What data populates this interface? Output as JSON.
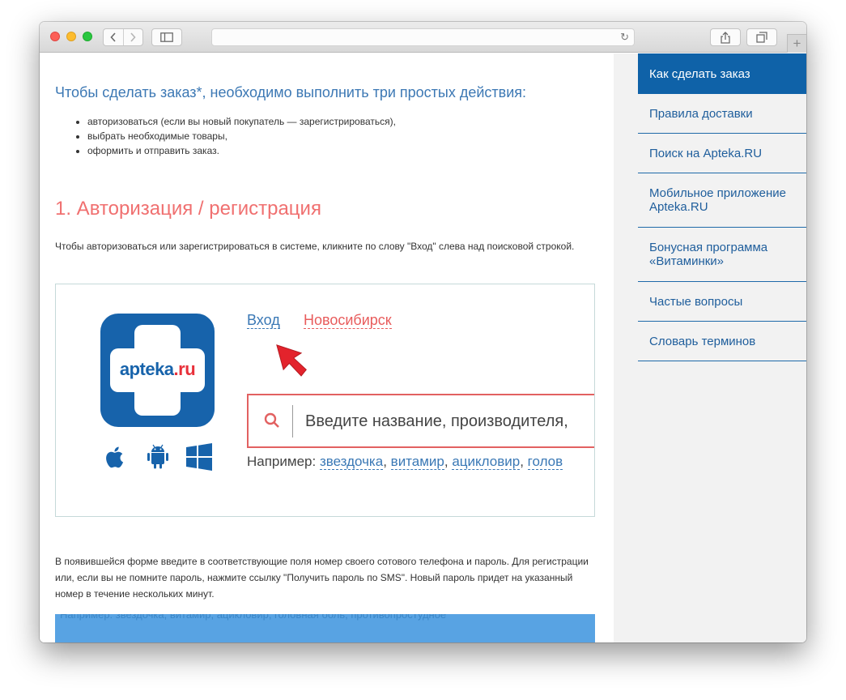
{
  "browser": {
    "reload_icon": "reload-icon",
    "back_icon": "chevron-left-icon",
    "forward_icon": "chevron-right-icon",
    "new_tab_label": "+"
  },
  "intro": {
    "heading": "Чтобы сделать заказ*, необходимо выполнить три простых действия:",
    "steps": [
      "авторизоваться (если вы новый покупатель — зарегистрироваться),",
      "выбрать необходимые товары,",
      "оформить и отправить заказ."
    ]
  },
  "section": {
    "heading": "1. Авторизация / регистрация",
    "paragraph1": "Чтобы авторизоваться или зарегистрироваться в системе, кликните по слову \"Вход\" слева над поисковой строкой.",
    "paragraph2": "В появившейся форме введите в соответствующие поля номер своего сотового телефона и пароль. Для регистрации или, если вы не помните пароль, нажмите ссылку \"Получить пароль по SMS\". Новый пароль придет на указанный номер в течение нескольких минут."
  },
  "figure": {
    "logo_text_main": "apteka",
    "logo_text_accent": ".ru",
    "login_link": "Вход",
    "city_link": "Новосибирск",
    "search_placeholder": "Введите название, производителя,",
    "examples_label": "Например: ",
    "examples": [
      "звездочка",
      "витамир",
      "ацикловир",
      "голов"
    ],
    "examples_sep": ", ",
    "band_text": "Например: звездочка, витамир, ацикловир, головная боль, противопростудное",
    "colors": {
      "brand_blue": "#1763ab",
      "accent_red": "#e8303a",
      "band_blue": "#58a3e3"
    }
  },
  "sidebar": {
    "items": [
      {
        "label": "Как сделать заказ",
        "active": true
      },
      {
        "label": "Правила доставки",
        "active": false
      },
      {
        "label": "Поиск на Apteka.RU",
        "active": false
      },
      {
        "label": "Мобильное приложение Apteka.RU",
        "active": false
      },
      {
        "label": "Бонусная программа «Витаминки»",
        "active": false
      },
      {
        "label": "Частые вопросы",
        "active": false
      },
      {
        "label": "Словарь терминов",
        "active": false
      }
    ]
  }
}
